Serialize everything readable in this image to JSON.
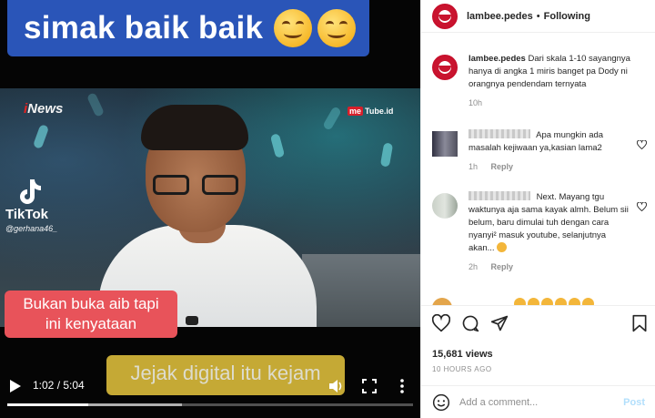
{
  "video": {
    "top_caption": "simak baik baik",
    "channel_watermark": "iNews",
    "metube_watermark": "Tube.id",
    "metube_badge": "me",
    "tiktok": {
      "brand": "TikTok",
      "user": "@gerhana46_"
    },
    "subtitle_red": [
      "Bukan buka aib tapi",
      "ini kenyataan"
    ],
    "subtitle_gold": "Jejak digital itu kejam",
    "controls": {
      "time": "1:02 / 5:04",
      "progress": 0.2,
      "buffered": 0.43,
      "icons": [
        "play-icon",
        "volume-icon",
        "fullscreen-icon",
        "more-vertical-icon"
      ]
    }
  },
  "header": {
    "username": "lambee.pedes",
    "separator": "•",
    "follow_status": "Following"
  },
  "caption": {
    "username": "lambee.pedes",
    "text": "Dari skala 1-10 sayangnya hanya di angka 1 miris banget pa Dody ni orangnya pendendam ternyata",
    "time": "10h"
  },
  "comments": [
    {
      "text": "Apa mungkin ada masalah kejiwaan ya,kasian lama2",
      "time": "1h",
      "reply_label": "Reply"
    },
    {
      "text": "Next. Mayang tgu waktunya aja sama kayak almh. Belum sii belum, baru dimulai tuh dengan cara nyanyi² masuk youtube, selanjutnya akan...",
      "time": "2h",
      "reply_label": "Reply"
    }
  ],
  "actions": {
    "icons": [
      "heart-icon",
      "comment-icon",
      "share-icon",
      "bookmark-icon"
    ],
    "views": "15,681 views",
    "posted_ago": "10 HOURS AGO"
  },
  "add_comment": {
    "placeholder": "Add a comment...",
    "post_label": "Post"
  },
  "colors": {
    "caption_blue": "#2a55b8",
    "subtitle_red": "#e8535a",
    "subtitle_gold": "#d6b73a",
    "post_disabled": "#b2dffc",
    "brand_red": "#c9142f"
  }
}
